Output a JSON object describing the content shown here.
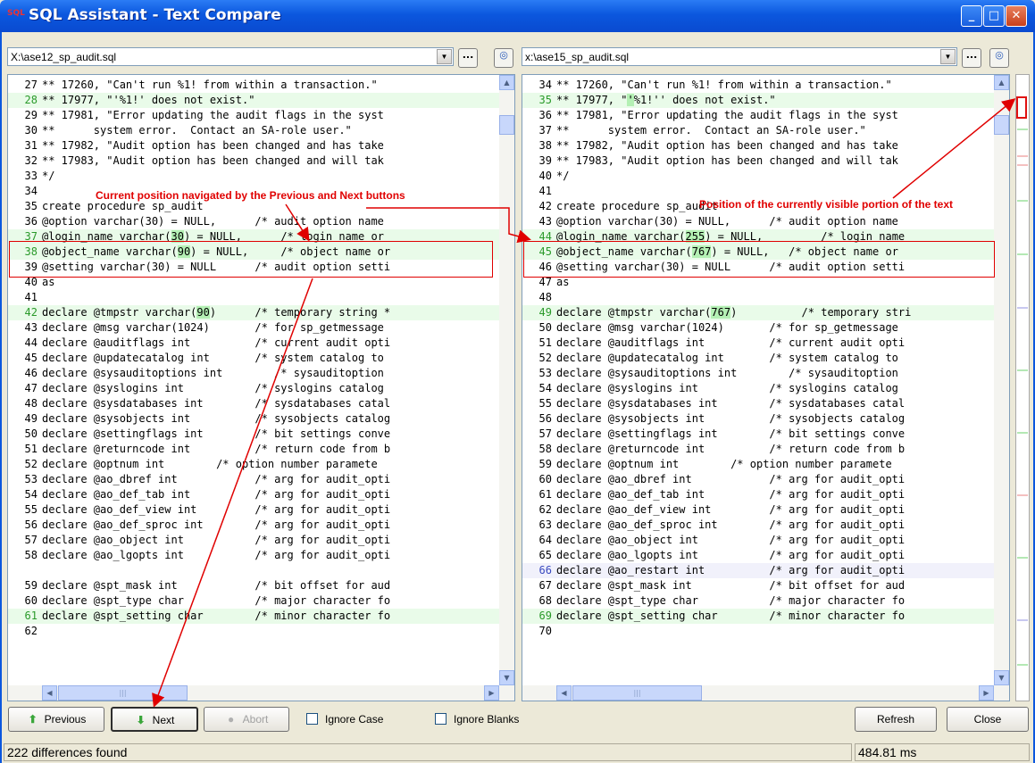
{
  "window": {
    "title": "SQL Assistant - Text Compare"
  },
  "left": {
    "file": "X:\\ase12_sp_audit.sql",
    "lines": [
      {
        "n": "27",
        "t": "** 17260, \"Can't run %1! from within a transaction.\"",
        "s": ""
      },
      {
        "n": "28",
        "t": "** 17977, \"'%1!' does not exist.\"",
        "s": "add"
      },
      {
        "n": "29",
        "t": "** 17981, \"Error updating the audit flags in the syst",
        "s": ""
      },
      {
        "n": "30",
        "t": "**      system error.  Contact an SA-role user.\"",
        "s": ""
      },
      {
        "n": "31",
        "t": "** 17982, \"Audit option has been changed and has take",
        "s": ""
      },
      {
        "n": "32",
        "t": "** 17983, \"Audit option has been changed and will tak",
        "s": ""
      },
      {
        "n": "33",
        "t": "*/",
        "s": ""
      },
      {
        "n": "34",
        "t": "",
        "s": ""
      },
      {
        "n": "35",
        "t": "create procedure sp_audit",
        "s": ""
      },
      {
        "n": "36",
        "t": "@option varchar(30) = NULL,      /* audit option name",
        "s": ""
      },
      {
        "n": "37",
        "t": "@login_name varchar(30) = NULL,      /* login name or",
        "s": "add",
        "hl": "30"
      },
      {
        "n": "38",
        "t": "@object_name varchar(90) = NULL,     /* object name or",
        "s": "add",
        "hl": "90"
      },
      {
        "n": "39",
        "t": "@setting varchar(30) = NULL      /* audit option setti",
        "s": ""
      },
      {
        "n": "40",
        "t": "as",
        "s": ""
      },
      {
        "n": "41",
        "t": "",
        "s": ""
      },
      {
        "n": "42",
        "t": "declare @tmpstr varchar(90)      /* temporary string *",
        "s": "add",
        "hl": "90"
      },
      {
        "n": "43",
        "t": "declare @msg varchar(1024)       /* for sp_getmessage",
        "s": ""
      },
      {
        "n": "44",
        "t": "declare @auditflags int          /* current audit opti",
        "s": ""
      },
      {
        "n": "45",
        "t": "declare @updatecatalog int       /* system catalog to",
        "s": ""
      },
      {
        "n": "46",
        "t": "declare @sysauditoptions int        /* sysauditoption",
        "s": ""
      },
      {
        "n": "47",
        "t": "declare @syslogins int           /* syslogins catalog",
        "s": ""
      },
      {
        "n": "48",
        "t": "declare @sysdatabases int        /* sysdatabases catal",
        "s": ""
      },
      {
        "n": "49",
        "t": "declare @sysobjects int          /* sysobjects catalog",
        "s": ""
      },
      {
        "n": "50",
        "t": "declare @settingflags int        /* bit settings conve",
        "s": ""
      },
      {
        "n": "51",
        "t": "declare @returncode int          /* return code from b",
        "s": ""
      },
      {
        "n": "52",
        "t": "declare @optnum int        /* option number paramete",
        "s": ""
      },
      {
        "n": "53",
        "t": "declare @ao_dbref int            /* arg for audit_opti",
        "s": ""
      },
      {
        "n": "54",
        "t": "declare @ao_def_tab int          /* arg for audit_opti",
        "s": ""
      },
      {
        "n": "55",
        "t": "declare @ao_def_view int         /* arg for audit_opti",
        "s": ""
      },
      {
        "n": "56",
        "t": "declare @ao_def_sproc int        /* arg for audit_opti",
        "s": ""
      },
      {
        "n": "57",
        "t": "declare @ao_object int           /* arg for audit_opti",
        "s": ""
      },
      {
        "n": "58",
        "t": "declare @ao_lgopts int           /* arg for audit_opti",
        "s": ""
      },
      {
        "n": "",
        "t": "",
        "s": ""
      },
      {
        "n": "59",
        "t": "declare @spt_mask int            /* bit offset for aud",
        "s": ""
      },
      {
        "n": "60",
        "t": "declare @spt_type char           /* major character fo",
        "s": ""
      },
      {
        "n": "61",
        "t": "declare @spt_setting char        /* minor character fo",
        "s": "add"
      },
      {
        "n": "62",
        "t": "",
        "s": ""
      }
    ]
  },
  "right": {
    "file": "x:\\ase15_sp_audit.sql",
    "lines": [
      {
        "n": "34",
        "t": "** 17260, \"Can't run %1! from within a transaction.\"",
        "s": ""
      },
      {
        "n": "35",
        "t": "** 17977, \"'%1!'' does not exist.\"",
        "s": "add",
        "hl": "'"
      },
      {
        "n": "36",
        "t": "** 17981, \"Error updating the audit flags in the syst",
        "s": ""
      },
      {
        "n": "37",
        "t": "**      system error.  Contact an SA-role user.\"",
        "s": ""
      },
      {
        "n": "38",
        "t": "** 17982, \"Audit option has been changed and has take",
        "s": ""
      },
      {
        "n": "39",
        "t": "** 17983, \"Audit option has been changed and will tak",
        "s": ""
      },
      {
        "n": "40",
        "t": "*/",
        "s": ""
      },
      {
        "n": "41",
        "t": "",
        "s": ""
      },
      {
        "n": "42",
        "t": "create procedure sp_audit",
        "s": ""
      },
      {
        "n": "43",
        "t": "@option varchar(30) = NULL,      /* audit option name",
        "s": ""
      },
      {
        "n": "44",
        "t": "@login_name varchar(255) = NULL,         /* login name",
        "s": "add",
        "hl": "255"
      },
      {
        "n": "45",
        "t": "@object_name varchar(767) = NULL,   /* object name or",
        "s": "add",
        "hl": "767"
      },
      {
        "n": "46",
        "t": "@setting varchar(30) = NULL      /* audit option setti",
        "s": ""
      },
      {
        "n": "47",
        "t": "as",
        "s": ""
      },
      {
        "n": "48",
        "t": "",
        "s": ""
      },
      {
        "n": "49",
        "t": "declare @tmpstr varchar(767)          /* temporary stri",
        "s": "add",
        "hl": "767"
      },
      {
        "n": "50",
        "t": "declare @msg varchar(1024)       /* for sp_getmessage",
        "s": ""
      },
      {
        "n": "51",
        "t": "declare @auditflags int          /* current audit opti",
        "s": ""
      },
      {
        "n": "52",
        "t": "declare @updatecatalog int       /* system catalog to",
        "s": ""
      },
      {
        "n": "53",
        "t": "declare @sysauditoptions int        /* sysauditoption",
        "s": ""
      },
      {
        "n": "54",
        "t": "declare @syslogins int           /* syslogins catalog",
        "s": ""
      },
      {
        "n": "55",
        "t": "declare @sysdatabases int        /* sysdatabases catal",
        "s": ""
      },
      {
        "n": "56",
        "t": "declare @sysobjects int          /* sysobjects catalog",
        "s": ""
      },
      {
        "n": "57",
        "t": "declare @settingflags int        /* bit settings conve",
        "s": ""
      },
      {
        "n": "58",
        "t": "declare @returncode int          /* return code from b",
        "s": ""
      },
      {
        "n": "59",
        "t": "declare @optnum int        /* option number paramete",
        "s": ""
      },
      {
        "n": "60",
        "t": "declare @ao_dbref int            /* arg for audit_opti",
        "s": ""
      },
      {
        "n": "61",
        "t": "declare @ao_def_tab int          /* arg for audit_opti",
        "s": ""
      },
      {
        "n": "62",
        "t": "declare @ao_def_view int         /* arg for audit_opti",
        "s": ""
      },
      {
        "n": "63",
        "t": "declare @ao_def_sproc int        /* arg for audit_opti",
        "s": ""
      },
      {
        "n": "64",
        "t": "declare @ao_object int           /* arg for audit_opti",
        "s": ""
      },
      {
        "n": "65",
        "t": "declare @ao_lgopts int           /* arg for audit_opti",
        "s": ""
      },
      {
        "n": "66",
        "t": "declare @ao_restart int          /* arg for audit_opti",
        "s": "chg"
      },
      {
        "n": "67",
        "t": "declare @spt_mask int            /* bit offset for aud",
        "s": ""
      },
      {
        "n": "68",
        "t": "declare @spt_type char           /* major character fo",
        "s": ""
      },
      {
        "n": "69",
        "t": "declare @spt_setting char        /* minor character fo",
        "s": "add"
      },
      {
        "n": "70",
        "t": "",
        "s": ""
      }
    ]
  },
  "annotations": {
    "nav_position": "Current position navigated by the Previous and Next buttons",
    "visible_position": "Position of the currently visible portion of the text"
  },
  "buttons": {
    "previous": "Previous",
    "next": "Next",
    "abort": "Abort",
    "refresh": "Refresh",
    "close": "Close",
    "browse": "...",
    "ignore_case": "Ignore Case",
    "ignore_blanks": "Ignore Blanks"
  },
  "status": {
    "differences": "222 differences found",
    "time": "484.81 ms"
  },
  "colors": {
    "added_line": "#e9fbe9",
    "changed_line": "#f1f1fb",
    "highlight": "#b4f0b4",
    "annotation": "#e00000",
    "titlebar": "#0b57de"
  },
  "icons": {
    "previous": "arrow-up-icon",
    "next": "arrow-down-icon",
    "abort": "stop-icon",
    "target": "target-icon"
  }
}
